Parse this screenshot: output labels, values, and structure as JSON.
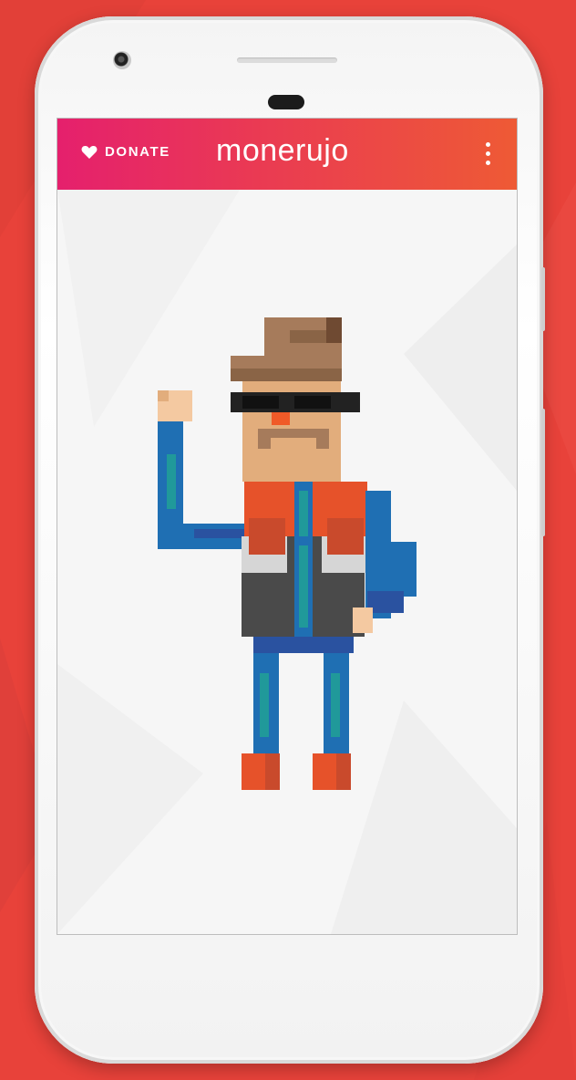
{
  "app": {
    "donate_label": "DONATE",
    "brand_name": "monerujo"
  },
  "icons": {
    "donate": "heart-icon",
    "menu": "more-vert-icon"
  },
  "colors": {
    "background": "#e8423a",
    "appbar_start": "#e5206d",
    "appbar_end": "#ee5a35",
    "content_bg": "#f6f6f6"
  }
}
